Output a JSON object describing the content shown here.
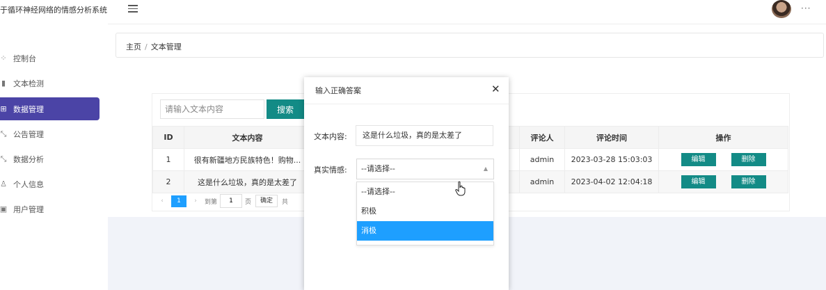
{
  "header": {
    "app_title": "于循环神经网络的情感分析系统",
    "menu_icon": "hamburger-icon",
    "more_icon": "···"
  },
  "sidebar": {
    "items": [
      {
        "icon": "dashboard-icon",
        "glyph": "⁘",
        "label": "控制台"
      },
      {
        "icon": "bar-chart-icon",
        "glyph": "▮",
        "label": "文本检测"
      },
      {
        "icon": "grid-icon",
        "glyph": "⊞",
        "label": "数据管理"
      },
      {
        "icon": "expand-icon",
        "glyph": "⤡",
        "label": "公告管理"
      },
      {
        "icon": "expand-icon",
        "glyph": "⤡",
        "label": "数据分析"
      },
      {
        "icon": "user-icon",
        "glyph": "♙",
        "label": "个人信息"
      },
      {
        "icon": "user-card-icon",
        "glyph": "▣",
        "label": "用户管理"
      }
    ],
    "active_color": "#4b44a6"
  },
  "breadcrumb": {
    "home": "主页",
    "separator": "/",
    "current": "文本管理"
  },
  "search": {
    "placeholder": "请输入文本内容",
    "button": "搜索"
  },
  "table": {
    "headers": [
      "ID",
      "文本内容",
      "评论人",
      "评论时间",
      "操作"
    ],
    "rows": [
      {
        "id": "1",
        "text": "很有新疆地方民族特色！购物...",
        "user": "admin",
        "time": "2023-03-28 15:03:03"
      },
      {
        "id": "2",
        "text": "这是什么垃圾，真的是太差了",
        "user": "admin",
        "time": "2023-04-02 12:04:18"
      }
    ],
    "edit_label": "编辑",
    "delete_label": "删除"
  },
  "pagination": {
    "prev": "‹",
    "current_page": "1",
    "next": "›",
    "goto_label": "到第",
    "goto_value": "1",
    "page_unit": "页",
    "confirm": "确定",
    "total": "共"
  },
  "modal": {
    "title": "输入正确答案",
    "close": "✕",
    "text_label": "文本内容:",
    "text_value": "这是什么垃圾，真的是太差了",
    "sentiment_label": "真实情感:",
    "select_value": "--请选择--",
    "options": [
      "--请选择--",
      "积极",
      "消极"
    ],
    "highlighted_option": "消极"
  },
  "colors": {
    "accent": "#138b86",
    "highlight": "#1e9fff",
    "content_bg": "#f1f3f9"
  }
}
